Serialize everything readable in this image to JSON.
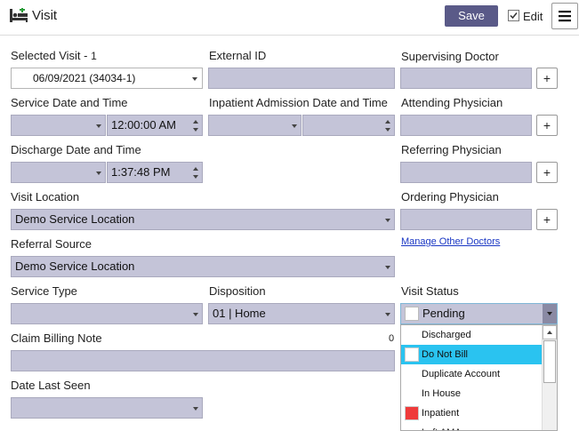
{
  "header": {
    "title": "Visit",
    "save_label": "Save",
    "edit_label": "Edit",
    "edit_checked": true
  },
  "fields": {
    "selected_visit_label": "Selected Visit - ",
    "selected_visit_count": "1",
    "selected_visit_value": "06/09/2021 (34034-1)",
    "external_id_label": "External ID",
    "supervising_doctor_label": "Supervising Doctor",
    "service_datetime_label": "Service Date and Time",
    "service_time_value": "12:00:00 AM",
    "inpatient_admission_label": "Inpatient Admission Date and Time",
    "attending_physician_label": "Attending Physician",
    "discharge_datetime_label": "Discharge Date and Time",
    "discharge_time_value": "1:37:48 PM",
    "referring_physician_label": "Referring Physician",
    "visit_location_label": "Visit Location",
    "visit_location_value": "Demo Service Location",
    "ordering_physician_label": "Ordering Physician",
    "manage_other_doctors_link": "Manage Other Doctors",
    "referral_source_label": "Referral Source",
    "referral_source_value": "Demo Service Location",
    "service_type_label": "Service Type",
    "disposition_label": "Disposition",
    "disposition_value": "01 | Home",
    "visit_status_label": "Visit Status",
    "visit_status_value": "Pending",
    "claim_billing_note_label": "Claim Billing Note",
    "claim_billing_note_count": "0",
    "date_last_seen_label": "Date Last Seen"
  },
  "plus_label": "+",
  "visit_status_options": [
    {
      "label": "Discharged",
      "swatch": "none"
    },
    {
      "label": "Do Not Bill",
      "swatch": "#ffffff"
    },
    {
      "label": "Duplicate Account",
      "swatch": "none"
    },
    {
      "label": "In House",
      "swatch": "none"
    },
    {
      "label": "Inpatient",
      "swatch": "#ef3b3b"
    },
    {
      "label": "Left AMA",
      "swatch": "none"
    }
  ],
  "highlighted_option": "Do Not Bill",
  "colors": {
    "field_bg": "#c4c4d8",
    "save_bg": "#5a5a88",
    "highlight": "#2ac3f0",
    "link": "#1a37c4",
    "inpatient_swatch": "#ef3b3b"
  }
}
